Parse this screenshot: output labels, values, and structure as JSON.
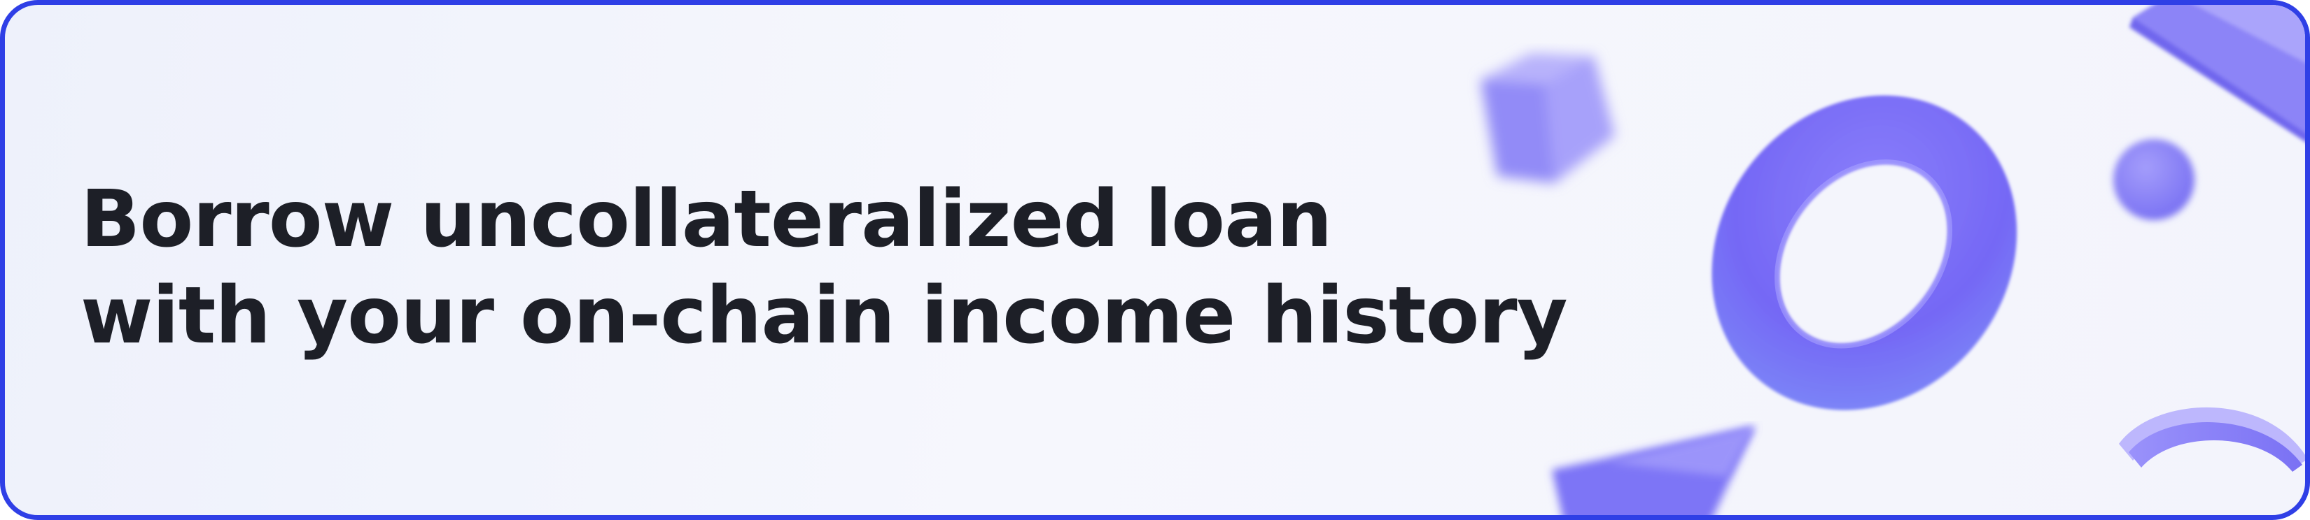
{
  "banner": {
    "headline_line1": "Borrow uncollateralized loan",
    "headline_line2": "with your on-chain income history"
  },
  "colors": {
    "border": "#2f3fe6",
    "background": "#f3f4fc",
    "text": "#1d1f27",
    "accent_purple": "#7b73f8"
  },
  "icons": [
    "cube-shape",
    "torus-ring-shape",
    "sphere-shape",
    "tile-shape",
    "arc-shape",
    "wedge-shape"
  ]
}
